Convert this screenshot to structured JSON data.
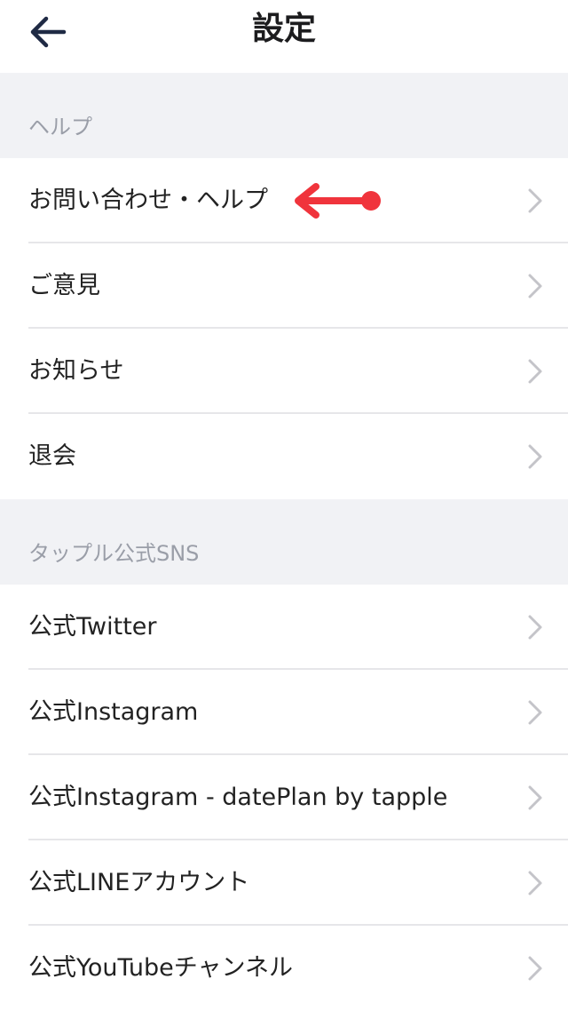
{
  "nav": {
    "title": "設定",
    "back_icon": "arrow-left-icon"
  },
  "sections": [
    {
      "header": "ヘルプ",
      "items": [
        {
          "label": "お問い合わせ・ヘルプ"
        },
        {
          "label": "ご意見"
        },
        {
          "label": "お知らせ"
        },
        {
          "label": "退会"
        }
      ]
    },
    {
      "header": "タップル公式SNS",
      "items": [
        {
          "label": "公式Twitter"
        },
        {
          "label": "公式Instagram"
        },
        {
          "label": "公式Instagram - datePlan by tapple"
        },
        {
          "label": "公式LINEアカウント"
        },
        {
          "label": "公式YouTubeチャンネル"
        }
      ]
    }
  ],
  "colors": {
    "annotation_arrow": "#f0343c",
    "chevron": "#c4c4c9",
    "section_bg": "#f1f2f5",
    "nav_text": "#1c1c1e"
  },
  "icons": {
    "row_chevron": "chevron-right-icon",
    "annotation": "red-arrow-annotation-icon"
  }
}
